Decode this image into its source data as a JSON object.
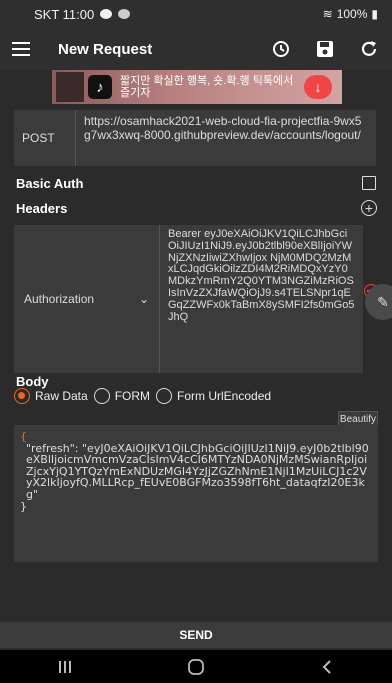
{
  "status": {
    "carrier_time": "SKT 11:00",
    "battery": "100%"
  },
  "app": {
    "title": "New Request"
  },
  "ad": {
    "text": "짧지만 확실한 행복, 숏.확.행 틱톡에서 즐기자"
  },
  "request": {
    "method": "POST",
    "url": "https://osamhack2021-web-cloud-fia-projectfia-9wx5g7wx3xwq-8000.githubpreview.dev/accounts/logout/"
  },
  "basic_auth": {
    "label": "Basic Auth"
  },
  "headers": {
    "label": "Headers",
    "rows": [
      {
        "key": "Authorization",
        "value": "Bearer eyJ0eXAiOiJKV1QiLCJhbGciOiJIUzI1NiJ9.eyJ0b2tlbl90eXBlIjoiYWNjZXNzIiwiZXhwIjox NjM0MDQ2MzMxLCJqdGkiOilzZDI4M2RiMDQxYzY0MDkzYmRmY2Q0YTM3NGZiMzRiOSIsInVzZXJfaWQiOjJ9.s4TELSNpr1qEGqZZWFx0kTaBmX8ySMFI2fs0mGo5JhQ"
      }
    ]
  },
  "body": {
    "label": "Body",
    "options": [
      "Raw Data",
      "FORM",
      "Form UrlEncoded"
    ],
    "selected": "Raw Data",
    "beautify_label": "Beautify",
    "raw_open": "{",
    "raw_content": "\"refresh\": \"eyJ0eXAiOiJKV1QiLCJhbGciOiJIUzI1NiJ9.eyJ0b2tlbl90eXBlIjoicmVmcmVzaCIsImV4cCI6MTYzNDA0NjMzMSwianRpIjoiZjcxYjQ1YTQzYmExNDUzMGI4YzJjZGZhNmE1NjI1MzUiLCJ1c2VyX2lkIjoyfQ.MLLRcp_fEUvE0BGFMzo3598fT6ht_dataqfzI20E3kg\"",
    "raw_close": "}"
  },
  "send": {
    "label": "SEND"
  },
  "icons": {
    "menu": "menu-icon",
    "history": "history-icon",
    "save": "save-icon",
    "refresh": "refresh-icon",
    "remove": "remove-circle-icon",
    "edit": "edit-pencil-icon",
    "add": "add-circle-icon"
  },
  "colors": {
    "accent": "#e56a2a",
    "remove": "#e04343",
    "background": "#2b2b2b",
    "field": "#3b3b3b"
  }
}
